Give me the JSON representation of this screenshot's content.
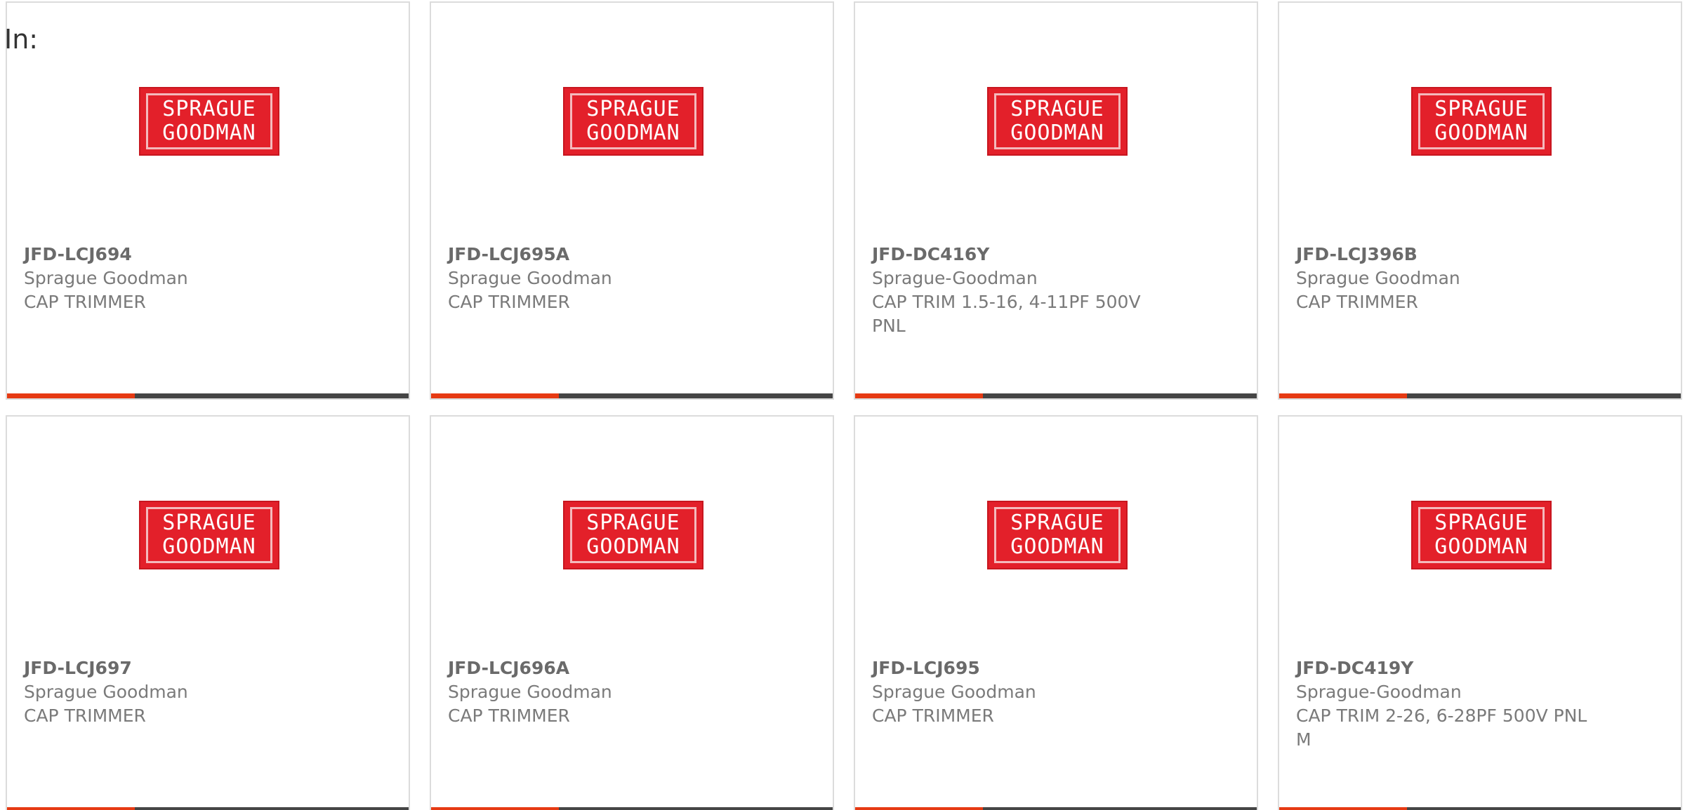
{
  "header": {
    "label": "In:"
  },
  "accent_color": "#e63a13",
  "bar_color": "#454545",
  "products": [
    {
      "part_number": "JFD-LCJ694",
      "manufacturer": "Sprague Goodman",
      "description": "CAP TRIMMER",
      "logo": {
        "line1": "SPRAGUE",
        "line2": "GOODMAN"
      }
    },
    {
      "part_number": "JFD-LCJ695A",
      "manufacturer": "Sprague Goodman",
      "description": "CAP TRIMMER",
      "logo": {
        "line1": "SPRAGUE",
        "line2": "GOODMAN"
      }
    },
    {
      "part_number": "JFD-DC416Y",
      "manufacturer": "Sprague-Goodman",
      "description": "CAP TRIM 1.5-16, 4-11PF 500V PNL",
      "logo": {
        "line1": "SPRAGUE",
        "line2": "GOODMAN"
      }
    },
    {
      "part_number": "JFD-LCJ396B",
      "manufacturer": "Sprague Goodman",
      "description": "CAP TRIMMER",
      "logo": {
        "line1": "SPRAGUE",
        "line2": "GOODMAN"
      }
    },
    {
      "part_number": "JFD-LCJ697",
      "manufacturer": "Sprague Goodman",
      "description": "CAP TRIMMER",
      "logo": {
        "line1": "SPRAGUE",
        "line2": "GOODMAN"
      }
    },
    {
      "part_number": "JFD-LCJ696A",
      "manufacturer": "Sprague Goodman",
      "description": "CAP TRIMMER",
      "logo": {
        "line1": "SPRAGUE",
        "line2": "GOODMAN"
      }
    },
    {
      "part_number": "JFD-LCJ695",
      "manufacturer": "Sprague Goodman",
      "description": "CAP TRIMMER",
      "logo": {
        "line1": "SPRAGUE",
        "line2": "GOODMAN"
      }
    },
    {
      "part_number": "JFD-DC419Y",
      "manufacturer": "Sprague-Goodman",
      "description": "CAP TRIM 2-26, 6-28PF 500V PNL M",
      "logo": {
        "line1": "SPRAGUE",
        "line2": "GOODMAN"
      }
    }
  ]
}
